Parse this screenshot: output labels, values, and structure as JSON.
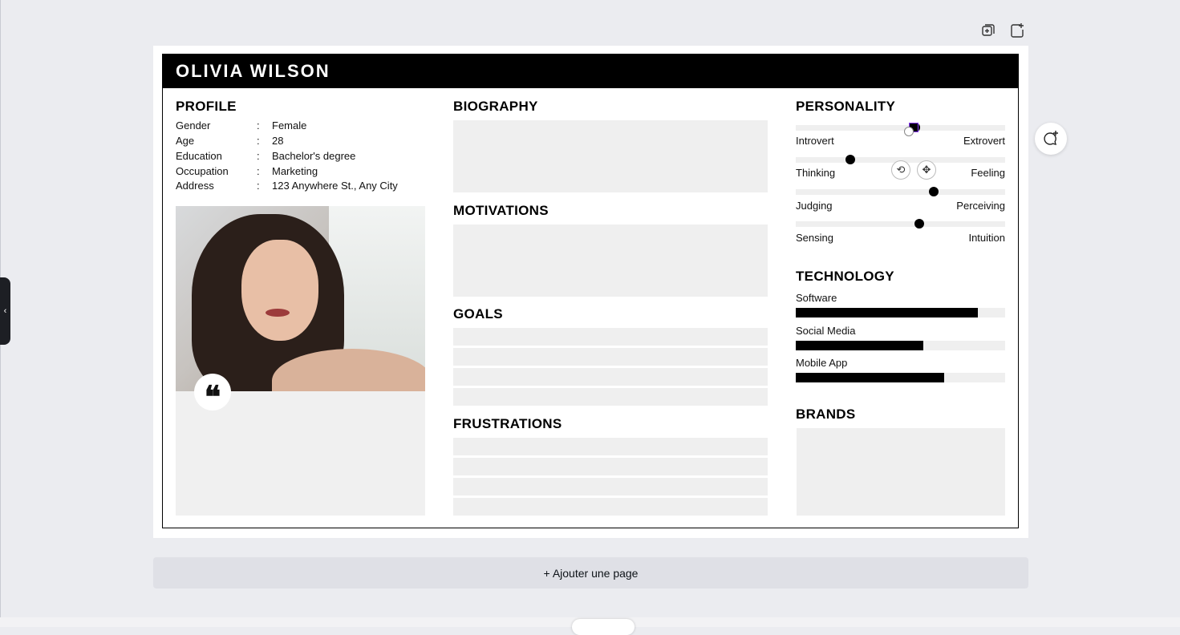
{
  "editor": {
    "copy_page_icon": "duplicate-page-icon",
    "add_page_icon": "add-page-icon",
    "comment_icon": "add-comment-icon",
    "collapse_icon": "chevron-left-icon",
    "add_page_label": "+ Ajouter une page"
  },
  "persona": {
    "name": "OLIVIA WILSON",
    "profile": {
      "title": "PROFILE",
      "rows": [
        {
          "key": "Gender",
          "sep": ":",
          "value": "Female"
        },
        {
          "key": "Age",
          "sep": ":",
          "value": "28"
        },
        {
          "key": "Education",
          "sep": ":",
          "value": "Bachelor's degree"
        },
        {
          "key": "Occupation",
          "sep": ":",
          "value": "Marketing"
        },
        {
          "key": "Address",
          "sep": ":",
          "value": "123 Anywhere St., Any City"
        }
      ],
      "quote_glyph": "❝"
    },
    "biography_title": "BIOGRAPHY",
    "motivations_title": "MOTIVATIONS",
    "goals_title": "GOALS",
    "frustrations_title": "FRUSTRATIONS",
    "personality": {
      "title": "PERSONALITY",
      "traits": [
        {
          "left": "Introvert",
          "right": "Extrovert",
          "value": 0.57
        },
        {
          "left": "Thinking",
          "right": "Feeling",
          "value": 0.26
        },
        {
          "left": "Judging",
          "right": "Perceiving",
          "value": 0.66
        },
        {
          "left": "Sensing",
          "right": "Intuition",
          "value": 0.59
        }
      ]
    },
    "technology": {
      "title": "TECHNOLOGY",
      "items": [
        {
          "label": "Software",
          "value": 0.87
        },
        {
          "label": "Social Media",
          "value": 0.61
        },
        {
          "label": "Mobile App",
          "value": 0.71
        }
      ]
    },
    "brands_title": "BRANDS"
  },
  "colors": {
    "canvas_bg": "#ebecf0",
    "header_bg": "#000000",
    "placeholder": "#efefef",
    "selection": "#8b3dff"
  }
}
